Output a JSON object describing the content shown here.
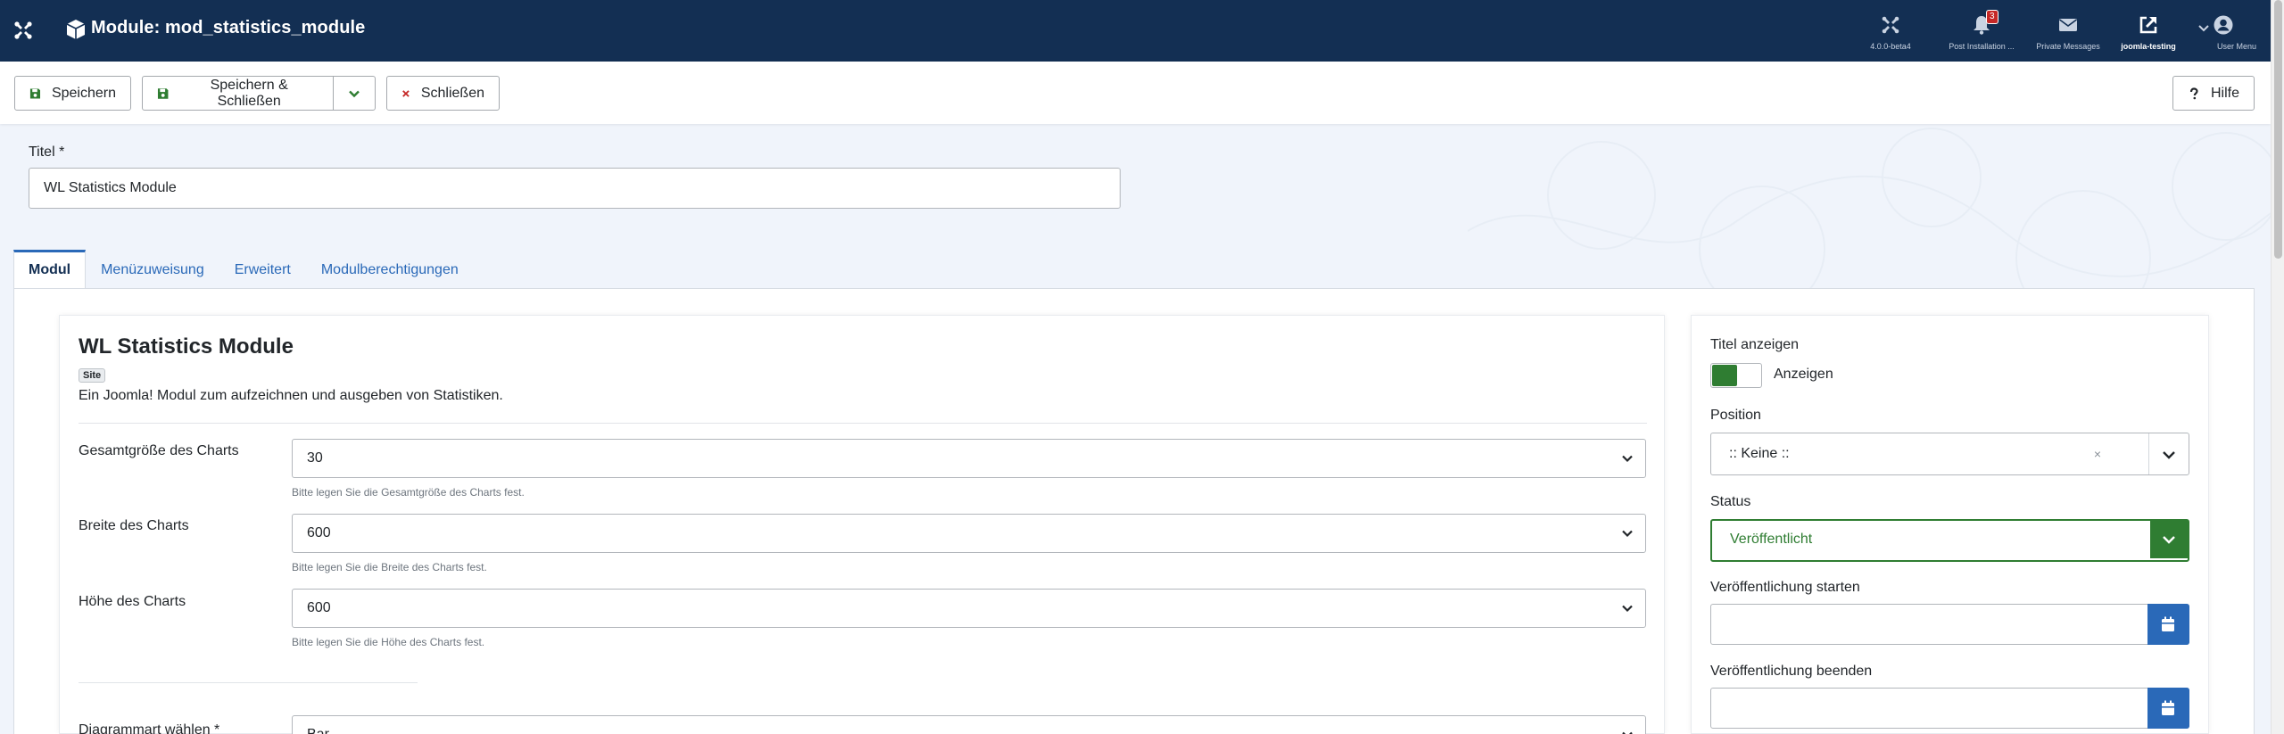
{
  "header": {
    "title": "Module: mod_statistics_module",
    "items": [
      {
        "label": "4.0.0-beta4",
        "icon": "joomla-icon"
      },
      {
        "label": "Post Installation ...",
        "icon": "bell-icon",
        "badge": "3"
      },
      {
        "label": "Private Messages",
        "icon": "envelope-icon"
      },
      {
        "label": "joomla-testing",
        "icon": "external-link-icon"
      },
      {
        "label": "User Menu",
        "icon": "user-icon"
      }
    ]
  },
  "toolbar": {
    "save": "Speichern",
    "save_close": "Speichern & Schließen",
    "close": "Schließen",
    "help": "Hilfe"
  },
  "title_field": {
    "label": "Titel *",
    "value": "WL Statistics Module"
  },
  "tabs": [
    "Modul",
    "Menüzuweisung",
    "Erweitert",
    "Modulberechtigungen"
  ],
  "module": {
    "name": "WL Statistics Module",
    "badge": "Site",
    "description": "Ein Joomla! Modul zum aufzeichnen und ausgeben von Statistiken."
  },
  "fields": [
    {
      "label": "Gesamtgröße des Charts",
      "value": "30",
      "hint": "Bitte legen Sie die Gesamtgröße des Charts fest."
    },
    {
      "label": "Breite des Charts",
      "value": "600",
      "hint": "Bitte legen Sie die Breite des Charts fest."
    },
    {
      "label": "Höhe des Charts",
      "value": "600",
      "hint": "Bitte legen Sie die Höhe des Charts fest."
    },
    {
      "label": "Diagrammart wählen *",
      "value": "Bar",
      "hint": ""
    }
  ],
  "sidebar": {
    "show_title_label": "Titel anzeigen",
    "show_title_value": "Anzeigen",
    "position_label": "Position",
    "position_value": ":: Keine ::",
    "position_clear": "×",
    "status_label": "Status",
    "status_value": "Veröffentlicht",
    "publish_up_label": "Veröffentlichung starten",
    "publish_down_label": "Veröffentlichung beenden"
  },
  "colors": {
    "header_bg": "#132f53",
    "published_green": "#2f7d32",
    "link_blue": "#2a69b8",
    "close_red": "#c52827"
  }
}
